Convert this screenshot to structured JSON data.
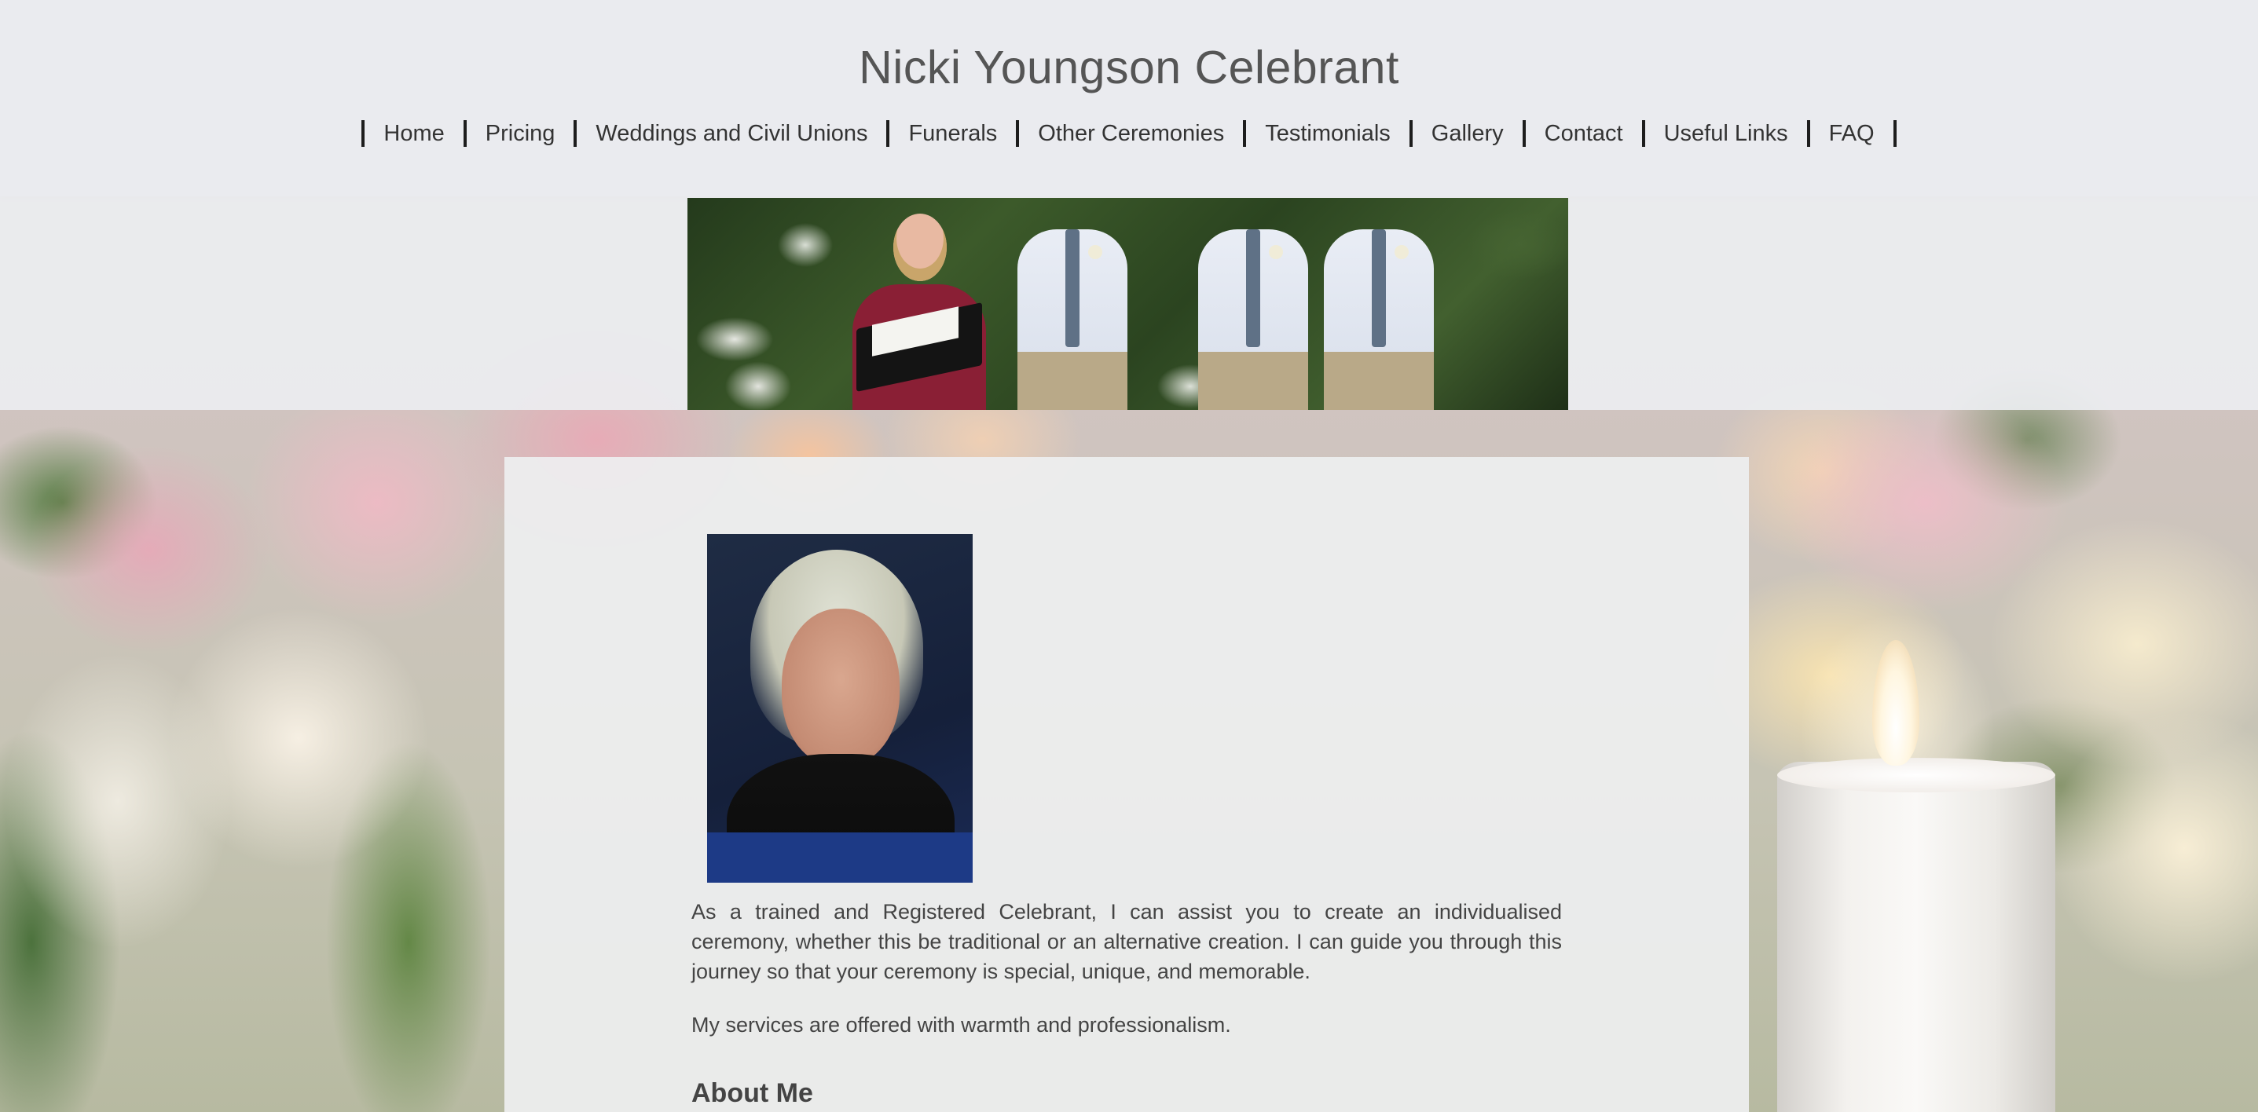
{
  "site": {
    "title": "Nicki Youngson Celebrant"
  },
  "nav": {
    "items": [
      "Home",
      "Pricing",
      "Weddings and Civil Unions",
      "Funerals",
      "Other Ceremonies",
      "Testimonials",
      "Gallery",
      "Contact",
      "Useful Links",
      "FAQ"
    ]
  },
  "main": {
    "intro": "As a trained and Registered Celebrant, I can assist you to create an individualised ceremony, whether this be traditional or an alternative creation. I can guide you through this journey so that your ceremony is special, unique, and memorable.",
    "services": "My services are offered with warmth and professionalism.",
    "about_heading": "About Me"
  },
  "colors": {
    "header_bg": "#eceef2",
    "text": "#444444",
    "nav_separator": "#1d1d1d"
  }
}
